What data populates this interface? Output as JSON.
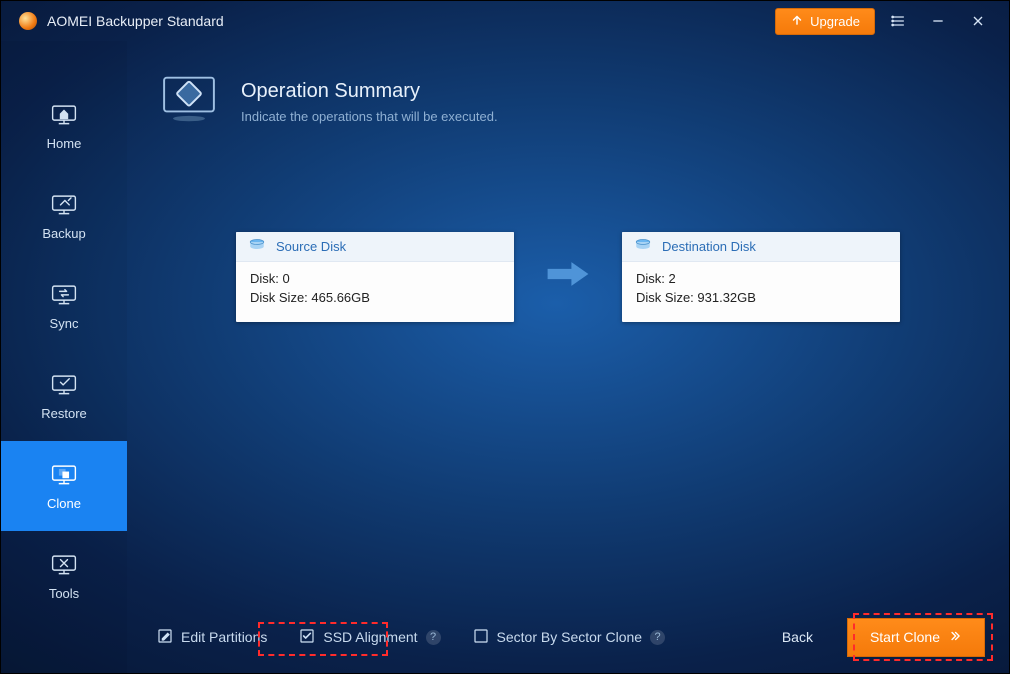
{
  "app": {
    "title": "AOMEI Backupper Standard",
    "upgrade_label": "Upgrade"
  },
  "sidebar": {
    "items": [
      {
        "id": "home",
        "label": "Home"
      },
      {
        "id": "backup",
        "label": "Backup"
      },
      {
        "id": "sync",
        "label": "Sync"
      },
      {
        "id": "restore",
        "label": "Restore"
      },
      {
        "id": "clone",
        "label": "Clone",
        "active": true
      },
      {
        "id": "tools",
        "label": "Tools"
      }
    ]
  },
  "header": {
    "title": "Operation Summary",
    "subtitle": "Indicate the operations that will be executed."
  },
  "source_card": {
    "head": "Source Disk",
    "line1": "Disk: 0",
    "line2": "Disk Size: 465.66GB"
  },
  "dest_card": {
    "head": "Destination Disk",
    "line1": "Disk: 2",
    "line2": "Disk Size: 931.32GB"
  },
  "footer": {
    "edit_partitions": "Edit Partitions",
    "ssd_alignment": "SSD Alignment",
    "sector_clone": "Sector By Sector Clone",
    "back": "Back",
    "start_clone": "Start Clone"
  }
}
